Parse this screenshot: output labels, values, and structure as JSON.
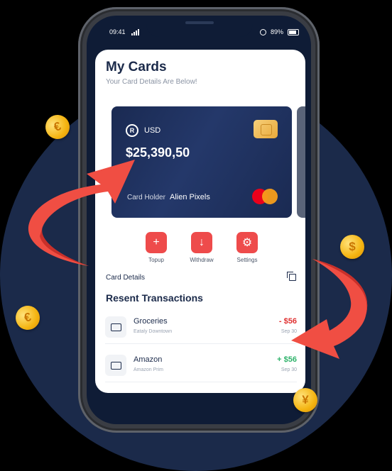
{
  "status": {
    "time": "09:41",
    "battery": "89%"
  },
  "app": {
    "title": "My Cards",
    "subtitle": "Your Card Details Are Below!"
  },
  "card": {
    "currency": "USD",
    "logo_glyph": "R",
    "balance": "$25,390,50",
    "holder_label": "Card Holder",
    "holder_name": "Alien Pixels"
  },
  "actions": [
    {
      "label": "Topup",
      "icon": "plus-icon",
      "glyph": "+"
    },
    {
      "label": "Withdraw",
      "icon": "arrow-down-icon",
      "glyph": "↓"
    },
    {
      "label": "Settings",
      "icon": "gear-icon",
      "glyph": "⚙"
    }
  ],
  "card_details_label": "Card Details",
  "transactions_title": "Resent Transactions",
  "transactions": [
    {
      "name": "Groceries",
      "place": "Eataly Downtown",
      "amount": "- $56",
      "date": "Sep 30",
      "color": "#e03131"
    },
    {
      "name": "Amazon",
      "place": "Amazon Prim",
      "amount": "+ $56",
      "date": "Sep 30",
      "color": "#2fb36b"
    }
  ],
  "coins": [
    {
      "symbol": "€"
    },
    {
      "symbol": "$"
    },
    {
      "symbol": "€"
    },
    {
      "symbol": "¥"
    }
  ],
  "colors": {
    "accent": "#ee4b4b",
    "navy": "#1b2a4a",
    "arrow": "#f04e43"
  }
}
